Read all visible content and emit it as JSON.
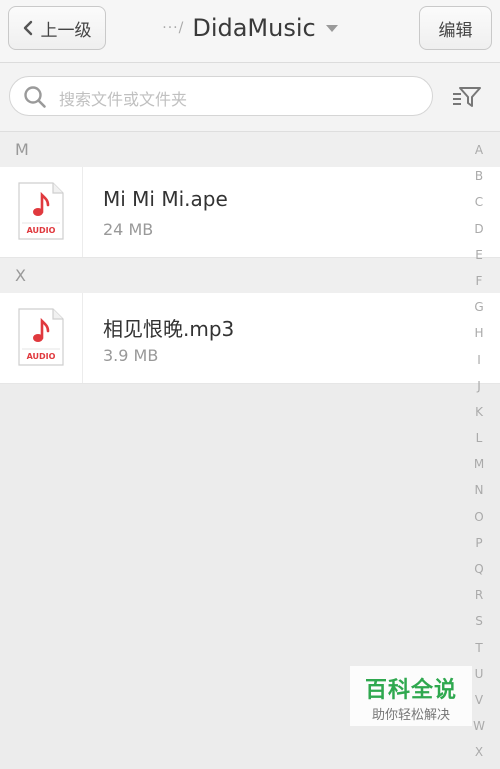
{
  "header": {
    "back_label": "上一级",
    "crumb": "···/",
    "title": "DidaMusic",
    "edit_label": "编辑"
  },
  "search": {
    "placeholder": "搜索文件或文件夹"
  },
  "sections": [
    {
      "letter": "M",
      "files": [
        {
          "name": "Mi Mi Mi.ape",
          "size": "24 MB",
          "icon_label": "AUDIO"
        }
      ]
    },
    {
      "letter": "X",
      "files": [
        {
          "name": "相见恨晚.mp3",
          "size": "3.9 MB",
          "icon_label": "AUDIO"
        }
      ]
    }
  ],
  "alpha_index": [
    "A",
    "B",
    "C",
    "D",
    "E",
    "F",
    "G",
    "H",
    "I",
    "J",
    "K",
    "L",
    "M",
    "N",
    "O",
    "P",
    "Q",
    "R",
    "S",
    "T",
    "U",
    "V",
    "W",
    "X"
  ],
  "watermark": {
    "title": "百科全说",
    "subtitle": "助你轻松解决"
  },
  "colors": {
    "audio_red": "#e0393e",
    "watermark_green": "#2fa84f"
  },
  "icons": {
    "back": "chevron-left-icon",
    "caret": "caret-down-icon",
    "search": "magnifier-icon",
    "filter": "filter-icon",
    "file": "audio-file-icon"
  }
}
